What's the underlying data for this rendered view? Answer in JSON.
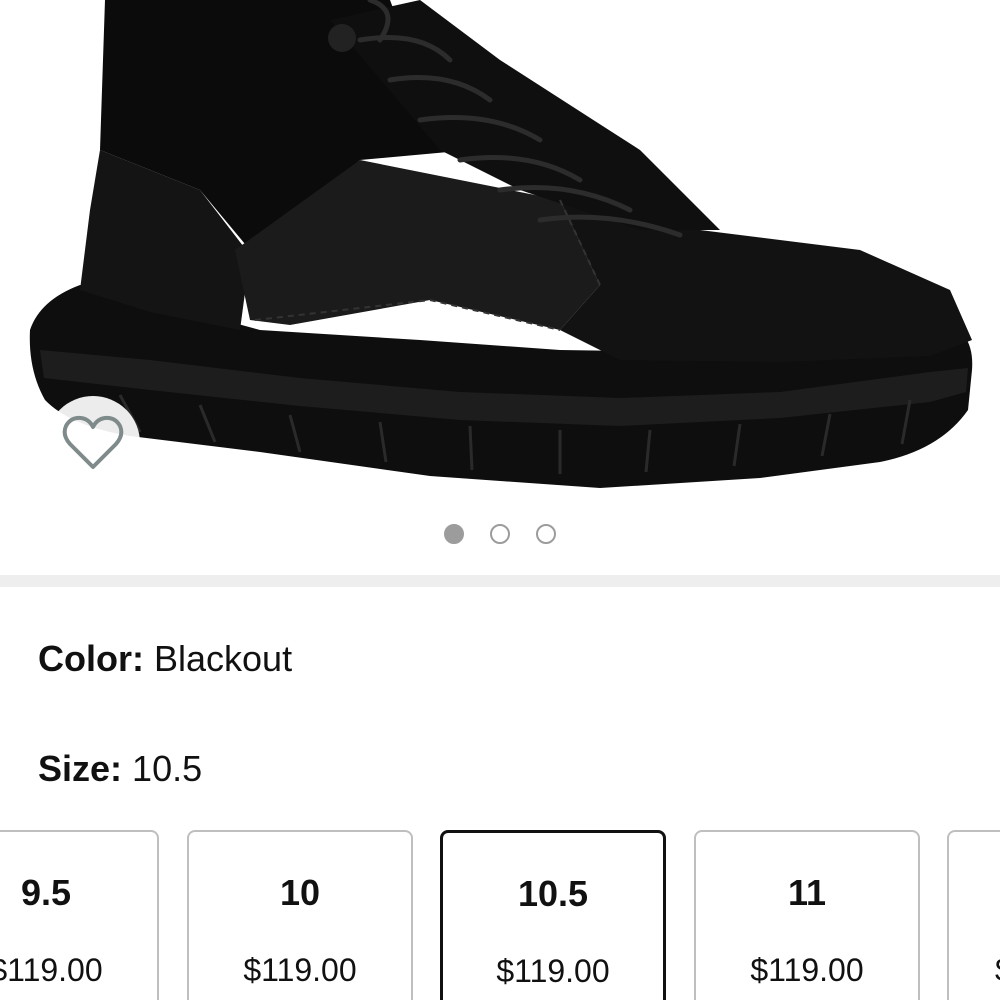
{
  "gallery": {
    "image_alt": "Blackout tactical boot",
    "active_index": 0,
    "total_images": 3
  },
  "variations": {
    "color_label": "Color:",
    "color_value": "Blackout",
    "size_label": "Size:",
    "size_value": "10.5"
  },
  "sizes": [
    {
      "size": "9.5",
      "price": "$119.00",
      "selected": false
    },
    {
      "size": "10",
      "price": "$119.00",
      "selected": false
    },
    {
      "size": "10.5",
      "price": "$119.00",
      "selected": true
    },
    {
      "size": "11",
      "price": "$119.00",
      "selected": false
    },
    {
      "size": "",
      "price": "$",
      "selected": false
    }
  ],
  "colors": {
    "boot": "#151515",
    "selected_border": "#111111",
    "tile_border": "#bfbfbf",
    "dot": "#9c9c9c",
    "divider": "#eeeeee"
  },
  "icons": {
    "wishlist": "heart-outline-icon"
  }
}
